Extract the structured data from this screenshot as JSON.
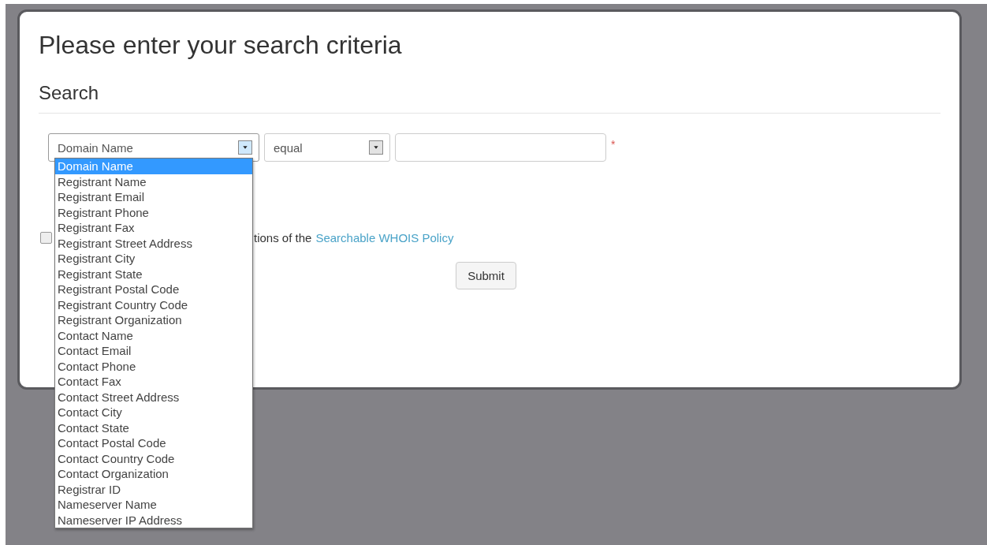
{
  "heading": "Please enter your search criteria",
  "section_title": "Search",
  "field_select": {
    "value": "Domain Name",
    "expanded": true,
    "options": [
      {
        "label": "Domain Name",
        "selected": true
      },
      {
        "label": "Registrant Name",
        "selected": false
      },
      {
        "label": "Registrant Email",
        "selected": false
      },
      {
        "label": "Registrant Phone",
        "selected": false
      },
      {
        "label": "Registrant Fax",
        "selected": false
      },
      {
        "label": "Registrant Street Address",
        "selected": false
      },
      {
        "label": "Registrant City",
        "selected": false
      },
      {
        "label": "Registrant State",
        "selected": false
      },
      {
        "label": "Registrant Postal Code",
        "selected": false
      },
      {
        "label": "Registrant Country Code",
        "selected": false
      },
      {
        "label": "Registrant Organization",
        "selected": false
      },
      {
        "label": "Contact Name",
        "selected": false
      },
      {
        "label": "Contact Email",
        "selected": false
      },
      {
        "label": "Contact Phone",
        "selected": false
      },
      {
        "label": "Contact Fax",
        "selected": false
      },
      {
        "label": "Contact Street Address",
        "selected": false
      },
      {
        "label": "Contact City",
        "selected": false
      },
      {
        "label": "Contact State",
        "selected": false
      },
      {
        "label": "Contact Postal Code",
        "selected": false
      },
      {
        "label": "Contact Country Code",
        "selected": false
      },
      {
        "label": "Contact Organization",
        "selected": false
      },
      {
        "label": "Registrar ID",
        "selected": false
      },
      {
        "label": "Nameserver Name",
        "selected": false
      },
      {
        "label": "Nameserver IP Address",
        "selected": false
      }
    ]
  },
  "operator_select": {
    "value": "equal"
  },
  "required_mark": "*",
  "agreement": {
    "checked": false,
    "label": "tions of the",
    "link": "Searchable WHOIS Policy"
  },
  "submit_button": "Submit"
}
